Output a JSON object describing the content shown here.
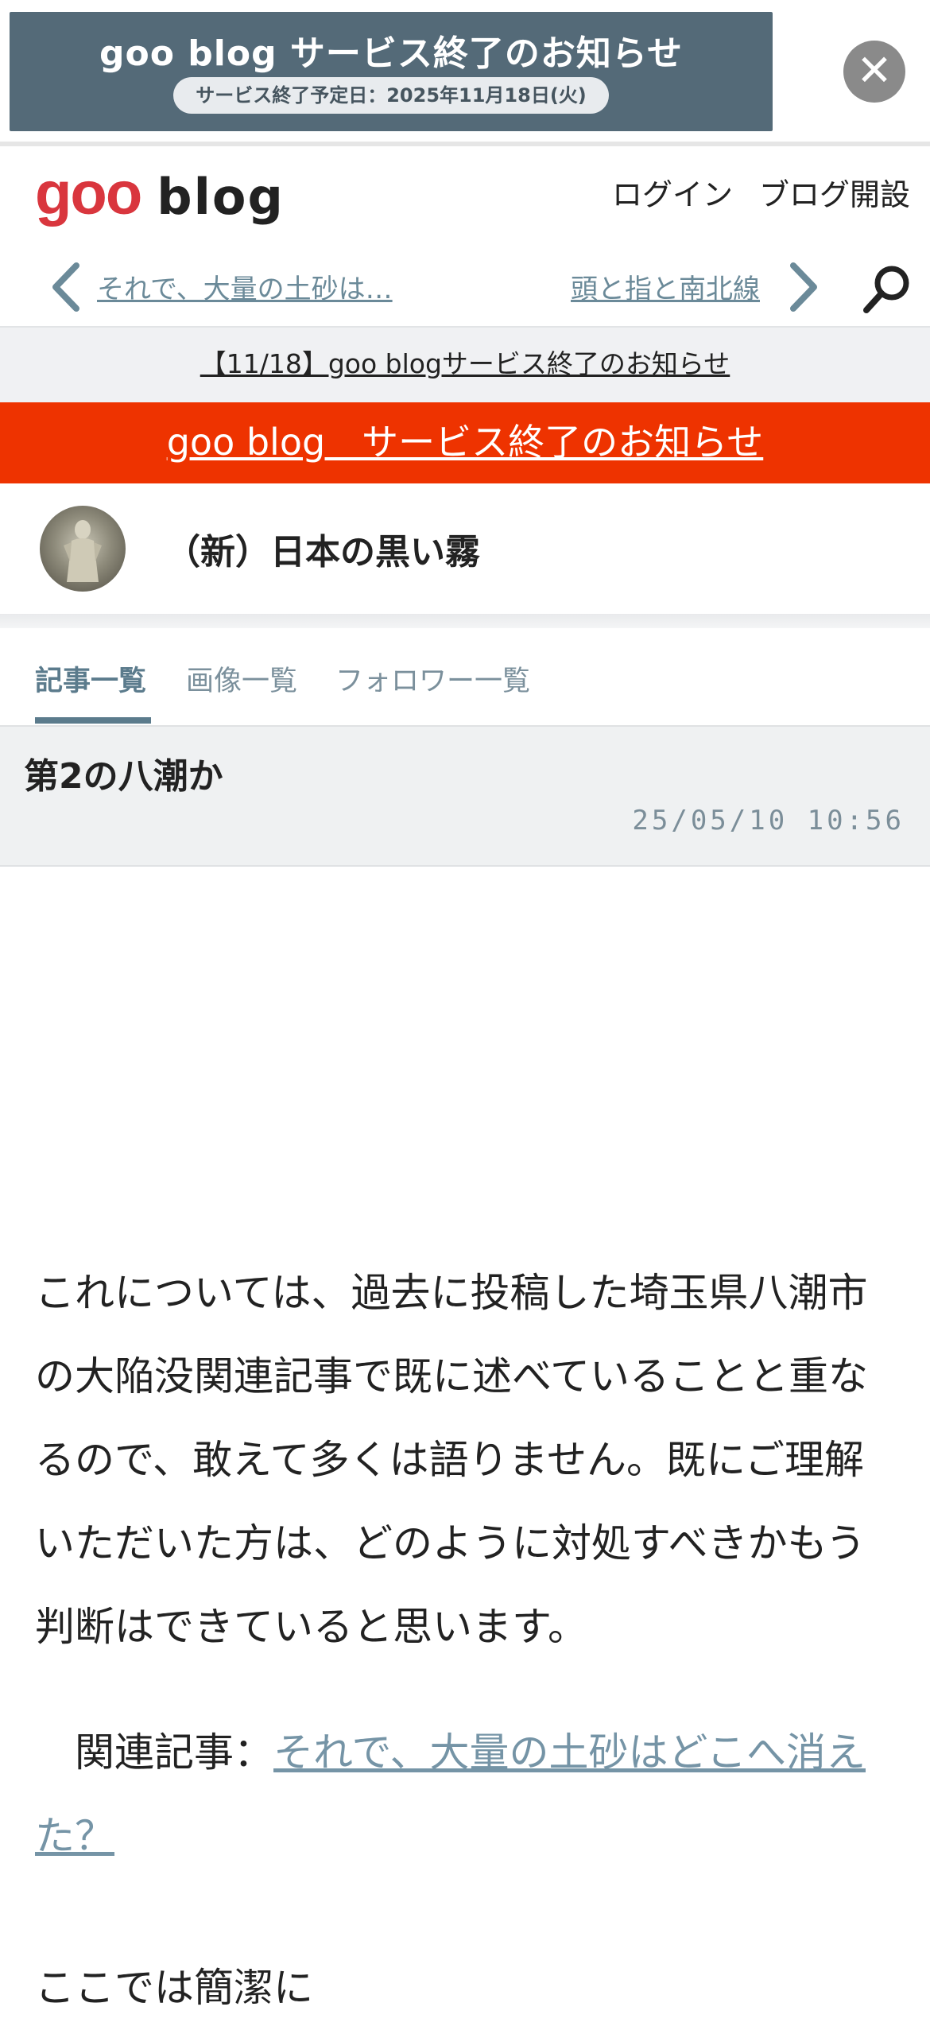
{
  "ad": {
    "title": "goo blog サービス終了のお知らせ",
    "subtitle": "サービス終了予定日：2025年11月18日(火)",
    "close_symbol": "✕"
  },
  "header": {
    "logo_goo": "goo",
    "logo_blog": "blog",
    "login": "ログイン",
    "open_blog": "ブログ開設"
  },
  "nav": {
    "prev_title": "それで、大量の土砂は…",
    "next_title": "頭と指と南北線"
  },
  "notice": "【11/18】goo blogサービス終了のお知らせ",
  "red_banner": "goo blog　サービス終了のお知らせ",
  "blog": {
    "title": "（新）日本の黒い霧"
  },
  "tabs": [
    {
      "label": "記事一覧"
    },
    {
      "label": "画像一覧"
    },
    {
      "label": "フォロワー一覧"
    }
  ],
  "post": {
    "title": "第2の八潮か",
    "date": "25/05/10 10:56",
    "paragraph_1": "これについては、過去に投稿した埼玉県八潮市の大陥没関連記事で既に述べていることと重なるので、敢えて多くは語りません。既にご理解いただいた方は、どのように対処すべきかもう判断はできていると思います。",
    "related_prefix": "　関連記事：",
    "related_link": "それで、大量の土砂はどこへ消えた？",
    "paragraph_2": "ここでは簡潔に"
  },
  "colors": {
    "ad_bg": "#546a78",
    "red_banner": "#ee3300",
    "accent": "#5b7b8c",
    "link": "#7594a6",
    "logo_red": "#d9363e"
  }
}
